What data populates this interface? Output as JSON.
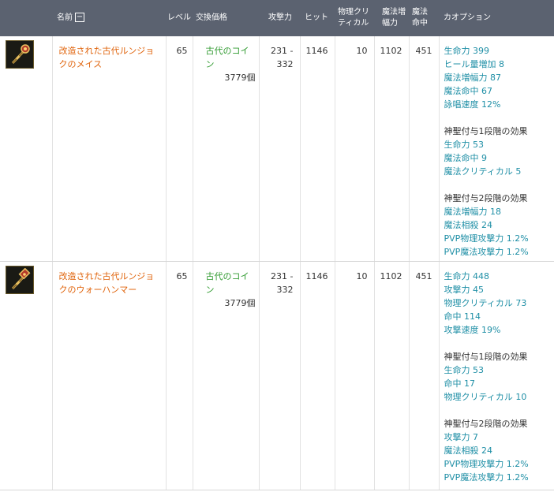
{
  "header": {
    "name": "名前",
    "toggle": "−",
    "level": "レベル",
    "exchange": "交換価格",
    "attack": "攻撃力",
    "hit": "ヒット",
    "phys_crit_1": "物理クリ",
    "phys_crit_2": "ティカル",
    "mag_amp_1": "魔法増",
    "mag_amp_2": "幅力",
    "mag_hit_1": "魔法",
    "mag_hit_2": "命中",
    "options": "カオプション"
  },
  "rows": [
    {
      "icon": "mace-icon",
      "name": "改造された古代ルンジョクのメイス",
      "level": "65",
      "coin": "古代のコイン",
      "qty": "3779個",
      "atk_1": "231 -",
      "atk_2": "332",
      "hit": "1146",
      "phys_crit": "10",
      "mag_amp": "1102",
      "mag_hit": "451",
      "options": {
        "base": [
          "生命力 399",
          "ヒール量増加 8",
          "魔法増幅力 87",
          "魔法命中 67",
          "詠唱速度 12%"
        ],
        "stage1_title": "神聖付与1段階の効果",
        "stage1": [
          "生命力 53",
          "魔法命中 9",
          "魔法クリティカル 5"
        ],
        "stage2_title": "神聖付与2段階の効果",
        "stage2": [
          "魔法増幅力 18",
          "魔法相殺 24",
          "PVP物理攻撃力 1.2%",
          "PVP魔法攻撃力 1.2%"
        ]
      }
    },
    {
      "icon": "warhammer-icon",
      "name": "改造された古代ルンジョクのウォーハンマー",
      "level": "65",
      "coin": "古代のコイン",
      "qty": "3779個",
      "atk_1": "231 -",
      "atk_2": "332",
      "hit": "1146",
      "phys_crit": "10",
      "mag_amp": "1102",
      "mag_hit": "451",
      "options": {
        "base": [
          "生命力 448",
          "攻撃力 45",
          "物理クリティカル 73",
          "命中 114",
          "攻撃速度 19%"
        ],
        "stage1_title": "神聖付与1段階の効果",
        "stage1": [
          "生命力 53",
          "命中 17",
          "物理クリティカル 10"
        ],
        "stage2_title": "神聖付与2段階の効果",
        "stage2": [
          "攻撃力 7",
          "魔法相殺 24",
          "PVP物理攻撃力 1.2%",
          "PVP魔法攻撃力 1.2%"
        ]
      }
    }
  ]
}
